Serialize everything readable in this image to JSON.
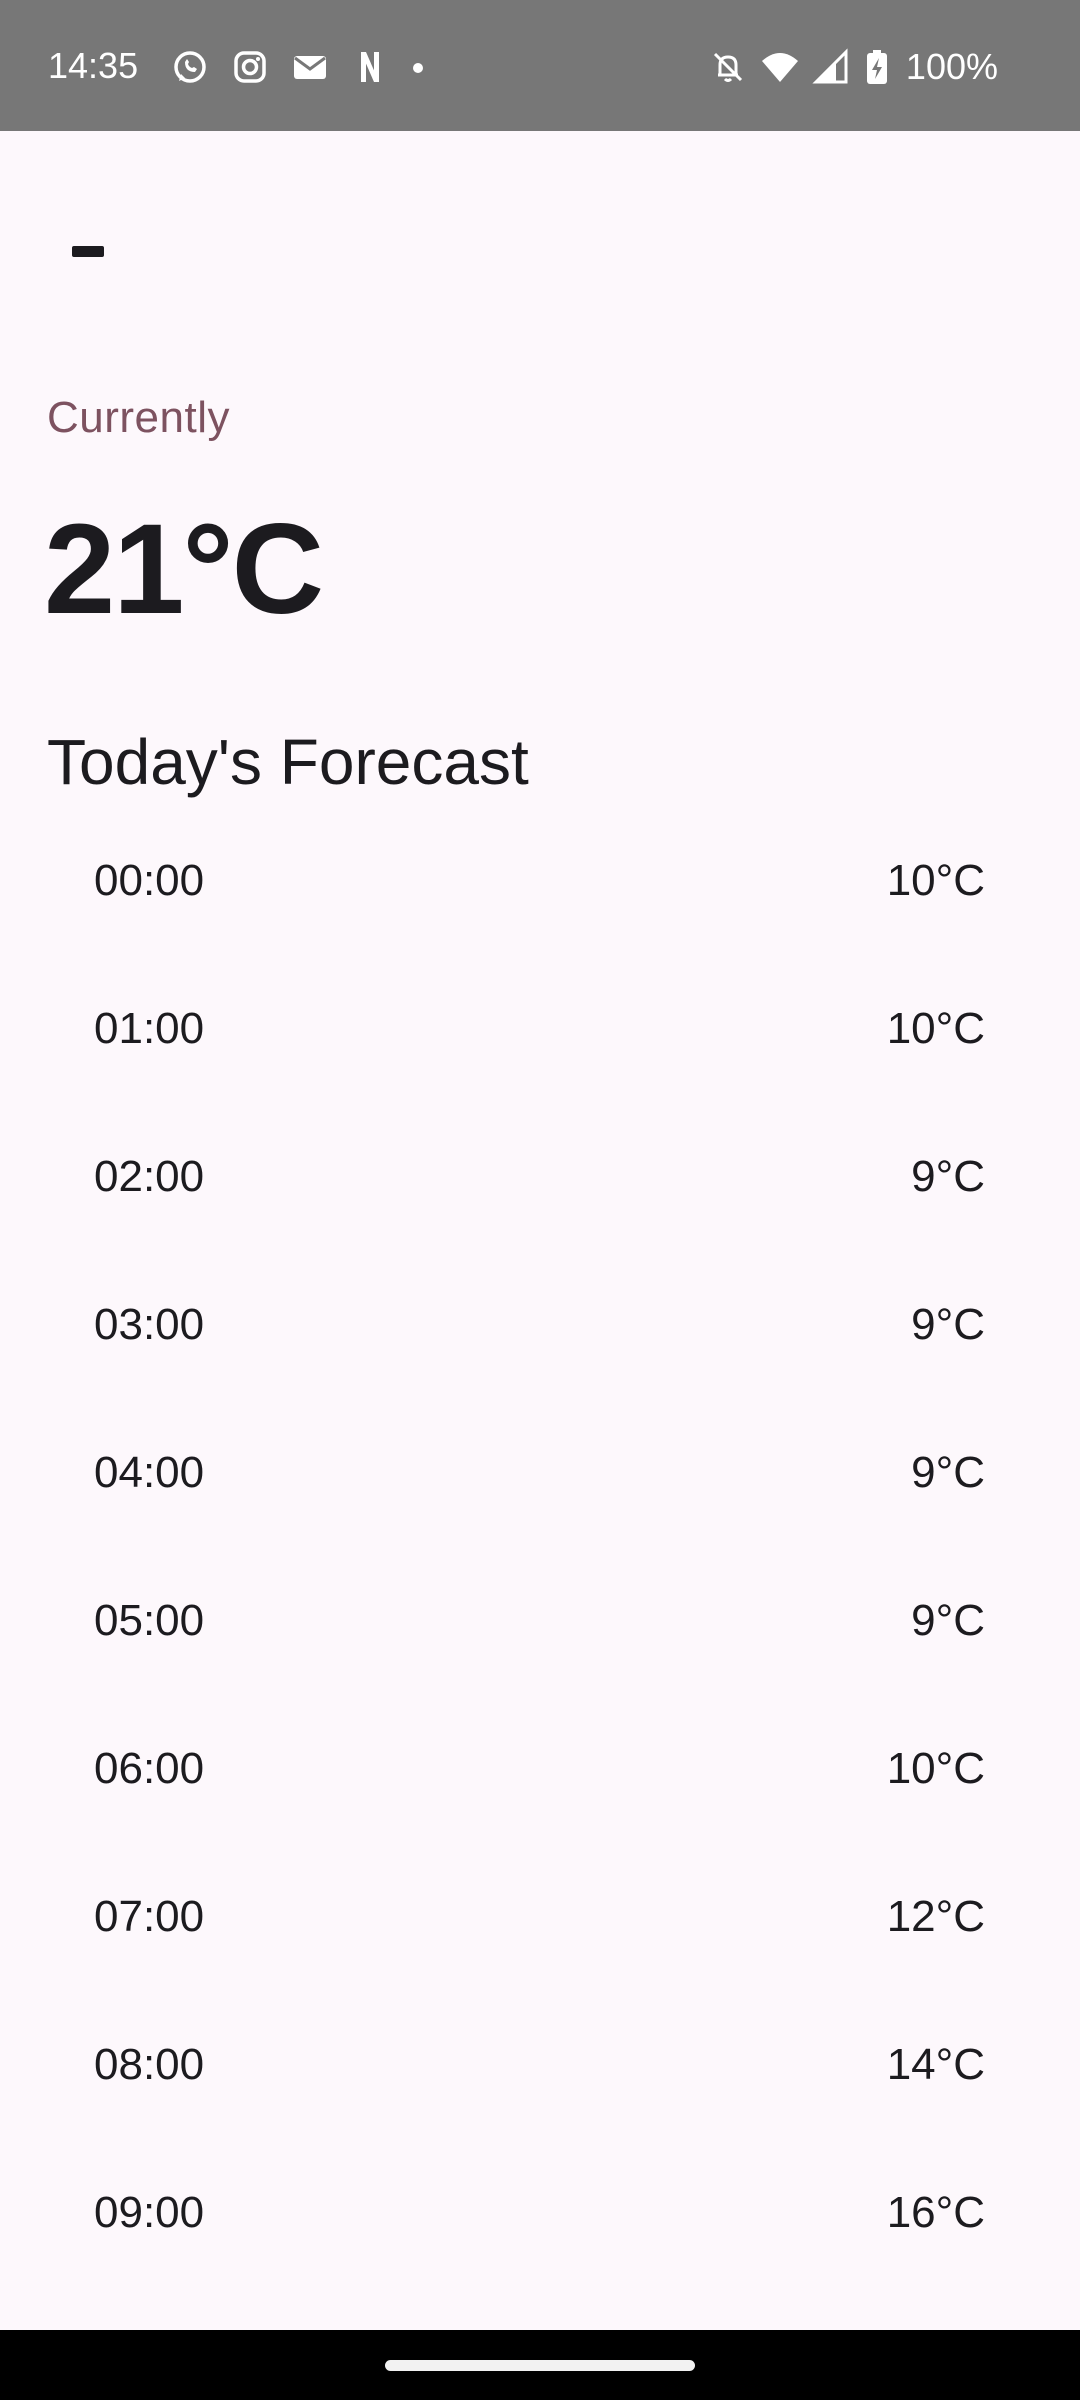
{
  "status_bar": {
    "time": "14:35",
    "battery": "100%",
    "left_icons": [
      "whatsapp-icon",
      "instagram-icon",
      "mail-icon",
      "netflix-icon",
      "dot-icon"
    ],
    "right_icons": [
      "bell-off-icon",
      "wifi-icon",
      "signal-icon",
      "battery-charging-icon"
    ]
  },
  "current": {
    "label": "Currently",
    "temperature": "21°C"
  },
  "forecast": {
    "title": "Today's Forecast",
    "rows": [
      {
        "time": "00:00",
        "temp": "10°C"
      },
      {
        "time": "01:00",
        "temp": "10°C"
      },
      {
        "time": "02:00",
        "temp": "9°C"
      },
      {
        "time": "03:00",
        "temp": "9°C"
      },
      {
        "time": "04:00",
        "temp": "9°C"
      },
      {
        "time": "05:00",
        "temp": "9°C"
      },
      {
        "time": "06:00",
        "temp": "10°C"
      },
      {
        "time": "07:00",
        "temp": "12°C"
      },
      {
        "time": "08:00",
        "temp": "14°C"
      },
      {
        "time": "09:00",
        "temp": "16°C"
      }
    ]
  },
  "colors": {
    "background": "#fdf8fc",
    "status_bar": "#777777",
    "accent_label": "#7d5260",
    "text": "#1c1b1f"
  }
}
